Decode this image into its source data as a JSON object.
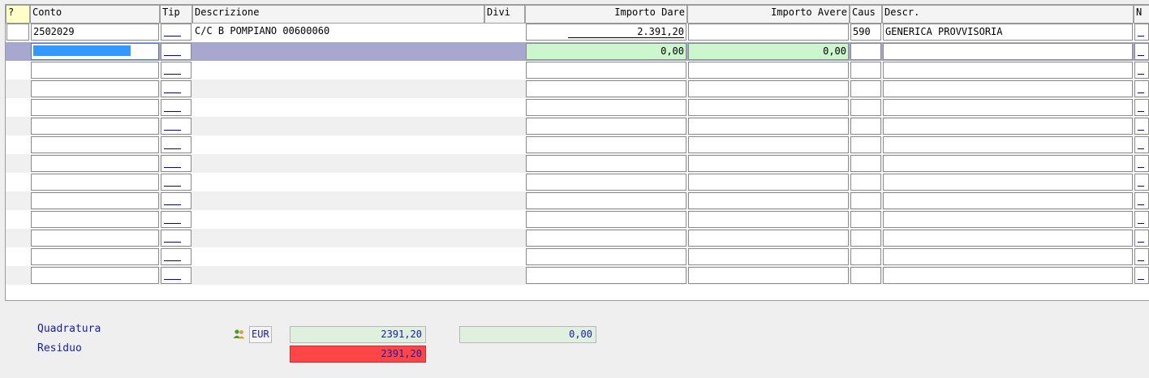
{
  "grid": {
    "headers": {
      "q": "?",
      "conto": "Conto",
      "tip": "Tip",
      "descrizione": "Descrizione",
      "divi": "Divi",
      "importo_dare": "Importo Dare",
      "importo_avere": "Importo Avere",
      "caus": "Caus",
      "descr": "Descr.",
      "n": "N"
    },
    "row1": {
      "conto": "2502029",
      "descrizione": "C/C B   POMPIANO  00600060",
      "importo_dare": "2.391,20",
      "importo_avere": "",
      "caus": "590",
      "descr": "GENERICA PROVVISORIA"
    },
    "row2": {
      "conto": "",
      "importo_dare": "0,00",
      "importo_avere": "0,00"
    },
    "empty_rows": 12
  },
  "footer": {
    "quadratura_label": "Quadratura",
    "residuo_label": "Residuo",
    "currency": "EUR",
    "currency_icon": "users-icon",
    "quadratura_dare": "2391,20",
    "quadratura_avere": "0,00",
    "residuo_value": "2391,20",
    "residuo_color": "#ff4646"
  }
}
